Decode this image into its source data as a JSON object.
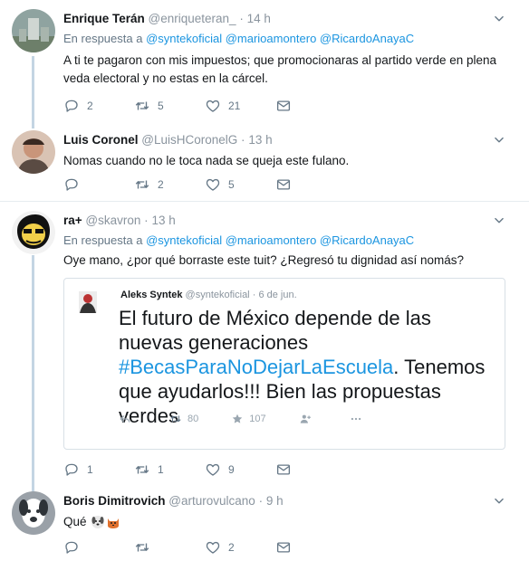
{
  "tweets": [
    {
      "name": "Enrique Terán",
      "handle": "@enriqueteran_",
      "separator": "·",
      "time": "14 h",
      "reply_prefix": "En respuesta a",
      "reply_mentions": "@syntekoficial @marioamontero @RicardoAnayaC",
      "text": "A ti te pagaron con mis impuestos; que promocionaras al partido verde en plena veda electoral y no estas en la cárcel.",
      "replies": "2",
      "retweets": "5",
      "likes": "21"
    },
    {
      "name": "Luis Coronel",
      "handle": "@LuisHCoronelG",
      "separator": "·",
      "time": "13 h",
      "text": "Nomas cuando no le toca nada se queja este fulano.",
      "replies": "",
      "retweets": "2",
      "likes": "5"
    },
    {
      "name": "ra+",
      "handle": "@skavron",
      "separator": "·",
      "time": "13 h",
      "reply_prefix": "En respuesta a",
      "reply_mentions": "@syntekoficial @marioamontero @RicardoAnayaC",
      "text": "Oye mano, ¿por qué borraste este tuit? ¿Regresó tu dignidad así nomás?",
      "replies": "1",
      "retweets": "1",
      "likes": "9",
      "quote": {
        "name": "Aleks Syntek",
        "handle": "@syntekoficial",
        "separator": "·",
        "date": "6 de jun.",
        "text_before": "El futuro de México depende de las nuevas generaciones ",
        "hashtag": "#BecasParaNoDejarLaEscuela",
        "text_after": ". Tenemos que ayudarlos!!! Bien las propuestas verdes",
        "retweets": "80",
        "likes": "107"
      }
    },
    {
      "name": "Boris Dimitrovich",
      "handle": "@arturovulcano",
      "separator": "·",
      "time": "9 h",
      "text": "Qué",
      "replies": "",
      "retweets": "",
      "likes": "2"
    }
  ],
  "colors": {
    "accent": "#1b95e0",
    "thread_line": "#c4d5e3",
    "muted": "#657786"
  }
}
